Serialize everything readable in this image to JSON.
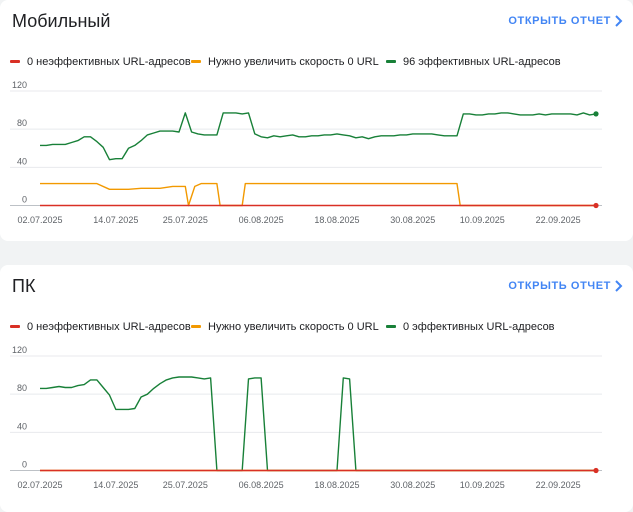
{
  "colors": {
    "poor": "#d93025",
    "needs_improvement": "#f29900",
    "good": "#188038",
    "grid": "#e8eaed",
    "link": "#4285f4"
  },
  "cards": [
    {
      "title": "Мобильный",
      "open_report_label": "ОТКРЫТЬ ОТЧЕТ",
      "legend": [
        "0 неэффективных URL-адресов",
        "Нужно увеличить скорость 0 URL",
        "96 эффективных URL-адресов"
      ]
    },
    {
      "title": "ПК",
      "open_report_label": "ОТКРЫТЬ ОТЧЕТ",
      "legend": [
        "0 неэффективных URL-адресов",
        "Нужно увеличить скорость 0 URL",
        "0 эффективных URL-адресов"
      ]
    }
  ],
  "chart_data": [
    {
      "type": "line",
      "title": "",
      "ylim": [
        0,
        120
      ],
      "yticks": [
        0,
        40,
        80,
        120
      ],
      "x_tick_labels": [
        "02.07.2025",
        "14.07.2025",
        "25.07.2025",
        "06.08.2025",
        "18.08.2025",
        "30.08.2025",
        "10.09.2025",
        "22.09.2025"
      ],
      "x_tick_days": [
        0,
        12,
        23,
        35,
        47,
        59,
        70,
        82
      ],
      "x_range_days": [
        0,
        88
      ],
      "grid": true,
      "legend_position": "top",
      "series": [
        {
          "name": "0 неэффективных URL-адресов",
          "key": "poor",
          "points": [
            [
              0,
              0
            ],
            [
              88,
              0
            ]
          ]
        },
        {
          "name": "Нужно увеличить скорость 0 URL",
          "key": "needs_improvement",
          "points": [
            [
              0,
              23
            ],
            [
              9,
              23
            ],
            [
              11,
              17
            ],
            [
              14,
              17
            ],
            [
              16,
              18
            ],
            [
              19,
              18
            ],
            [
              21,
              20
            ],
            [
              23,
              20
            ],
            [
              23.5,
              0
            ],
            [
              24.5,
              20
            ],
            [
              25.5,
              23
            ],
            [
              28,
              23
            ],
            [
              28.5,
              0
            ],
            [
              32,
              0
            ],
            [
              32.5,
              23
            ],
            [
              34,
              23
            ],
            [
              66,
              23
            ],
            [
              66.5,
              0
            ],
            [
              88,
              0
            ]
          ]
        },
        {
          "name": "96 эффективных URL-адресов",
          "key": "good",
          "points": [
            [
              0,
              63
            ],
            [
              1,
              63
            ],
            [
              2,
              64
            ],
            [
              3,
              64
            ],
            [
              4,
              64
            ],
            [
              5,
              66
            ],
            [
              6,
              68
            ],
            [
              7,
              72
            ],
            [
              8,
              72
            ],
            [
              9,
              67
            ],
            [
              10,
              61
            ],
            [
              11,
              48
            ],
            [
              12,
              49
            ],
            [
              13,
              49
            ],
            [
              14,
              60
            ],
            [
              15,
              63
            ],
            [
              16,
              68
            ],
            [
              17,
              74
            ],
            [
              18,
              76
            ],
            [
              19,
              78
            ],
            [
              20,
              78
            ],
            [
              21,
              78
            ],
            [
              22,
              77
            ],
            [
              23,
              97
            ],
            [
              24,
              77
            ],
            [
              25,
              75
            ],
            [
              26,
              74
            ],
            [
              27,
              74
            ],
            [
              28,
              74
            ],
            [
              29,
              97
            ],
            [
              30,
              97
            ],
            [
              31,
              97
            ],
            [
              32,
              96
            ],
            [
              33,
              97
            ],
            [
              34,
              75
            ],
            [
              35,
              72
            ],
            [
              36,
              71
            ],
            [
              37,
              73
            ],
            [
              38,
              72
            ],
            [
              39,
              73
            ],
            [
              40,
              74
            ],
            [
              41,
              72
            ],
            [
              42,
              72
            ],
            [
              43,
              73
            ],
            [
              44,
              73
            ],
            [
              45,
              74
            ],
            [
              46,
              74
            ],
            [
              47,
              75
            ],
            [
              48,
              74
            ],
            [
              49,
              73
            ],
            [
              50,
              71
            ],
            [
              51,
              72
            ],
            [
              52,
              70
            ],
            [
              53,
              72
            ],
            [
              54,
              73
            ],
            [
              55,
              73
            ],
            [
              56,
              73
            ],
            [
              57,
              74
            ],
            [
              58,
              74
            ],
            [
              59,
              75
            ],
            [
              60,
              75
            ],
            [
              61,
              75
            ],
            [
              62,
              75
            ],
            [
              63,
              74
            ],
            [
              64,
              73
            ],
            [
              65,
              73
            ],
            [
              66,
              73
            ],
            [
              67,
              96
            ],
            [
              68,
              96
            ],
            [
              69,
              95
            ],
            [
              70,
              95
            ],
            [
              71,
              96
            ],
            [
              72,
              96
            ],
            [
              73,
              97
            ],
            [
              74,
              97
            ],
            [
              75,
              96
            ],
            [
              76,
              95
            ],
            [
              77,
              95
            ],
            [
              78,
              95
            ],
            [
              79,
              96
            ],
            [
              80,
              95
            ],
            [
              81,
              96
            ],
            [
              82,
              96
            ],
            [
              83,
              96
            ],
            [
              84,
              96
            ],
            [
              85,
              95
            ],
            [
              86,
              97
            ],
            [
              87,
              95
            ],
            [
              88,
              96
            ]
          ]
        }
      ]
    },
    {
      "type": "line",
      "title": "",
      "ylim": [
        0,
        120
      ],
      "yticks": [
        0,
        40,
        80,
        120
      ],
      "x_tick_labels": [
        "02.07.2025",
        "14.07.2025",
        "25.07.2025",
        "06.08.2025",
        "18.08.2025",
        "30.08.2025",
        "10.09.2025",
        "22.09.2025"
      ],
      "x_tick_days": [
        0,
        12,
        23,
        35,
        47,
        59,
        70,
        82
      ],
      "x_range_days": [
        0,
        88
      ],
      "grid": true,
      "legend_position": "top",
      "series": [
        {
          "name": "0 неэффективных URL-адресов",
          "key": "poor",
          "points": [
            [
              0,
              0
            ],
            [
              88,
              0
            ]
          ]
        },
        {
          "name": "Нужно увеличить скорость 0 URL",
          "key": "needs_improvement",
          "points": [
            [
              0,
              0
            ],
            [
              88,
              0
            ]
          ]
        },
        {
          "name": "0 эффективных URL-адресов",
          "key": "good",
          "points": [
            [
              0,
              86
            ],
            [
              1,
              86
            ],
            [
              2,
              87
            ],
            [
              3,
              88
            ],
            [
              4,
              87
            ],
            [
              5,
              87
            ],
            [
              6,
              89
            ],
            [
              7,
              90
            ],
            [
              8,
              95
            ],
            [
              9,
              95
            ],
            [
              10,
              87
            ],
            [
              11,
              79
            ],
            [
              12,
              64
            ],
            [
              13,
              64
            ],
            [
              14,
              64
            ],
            [
              15,
              65
            ],
            [
              16,
              77
            ],
            [
              17,
              80
            ],
            [
              18,
              86
            ],
            [
              19,
              91
            ],
            [
              20,
              95
            ],
            [
              21,
              97
            ],
            [
              22,
              98
            ],
            [
              23,
              98
            ],
            [
              24,
              98
            ],
            [
              25,
              97
            ],
            [
              26,
              96
            ],
            [
              27,
              97
            ],
            [
              28,
              0
            ],
            [
              32,
              0
            ],
            [
              33,
              96
            ],
            [
              34,
              97
            ],
            [
              35,
              97
            ],
            [
              36,
              0
            ],
            [
              47,
              0
            ],
            [
              48,
              97
            ],
            [
              49,
              96
            ],
            [
              50,
              0
            ],
            [
              88,
              0
            ]
          ]
        }
      ]
    }
  ]
}
